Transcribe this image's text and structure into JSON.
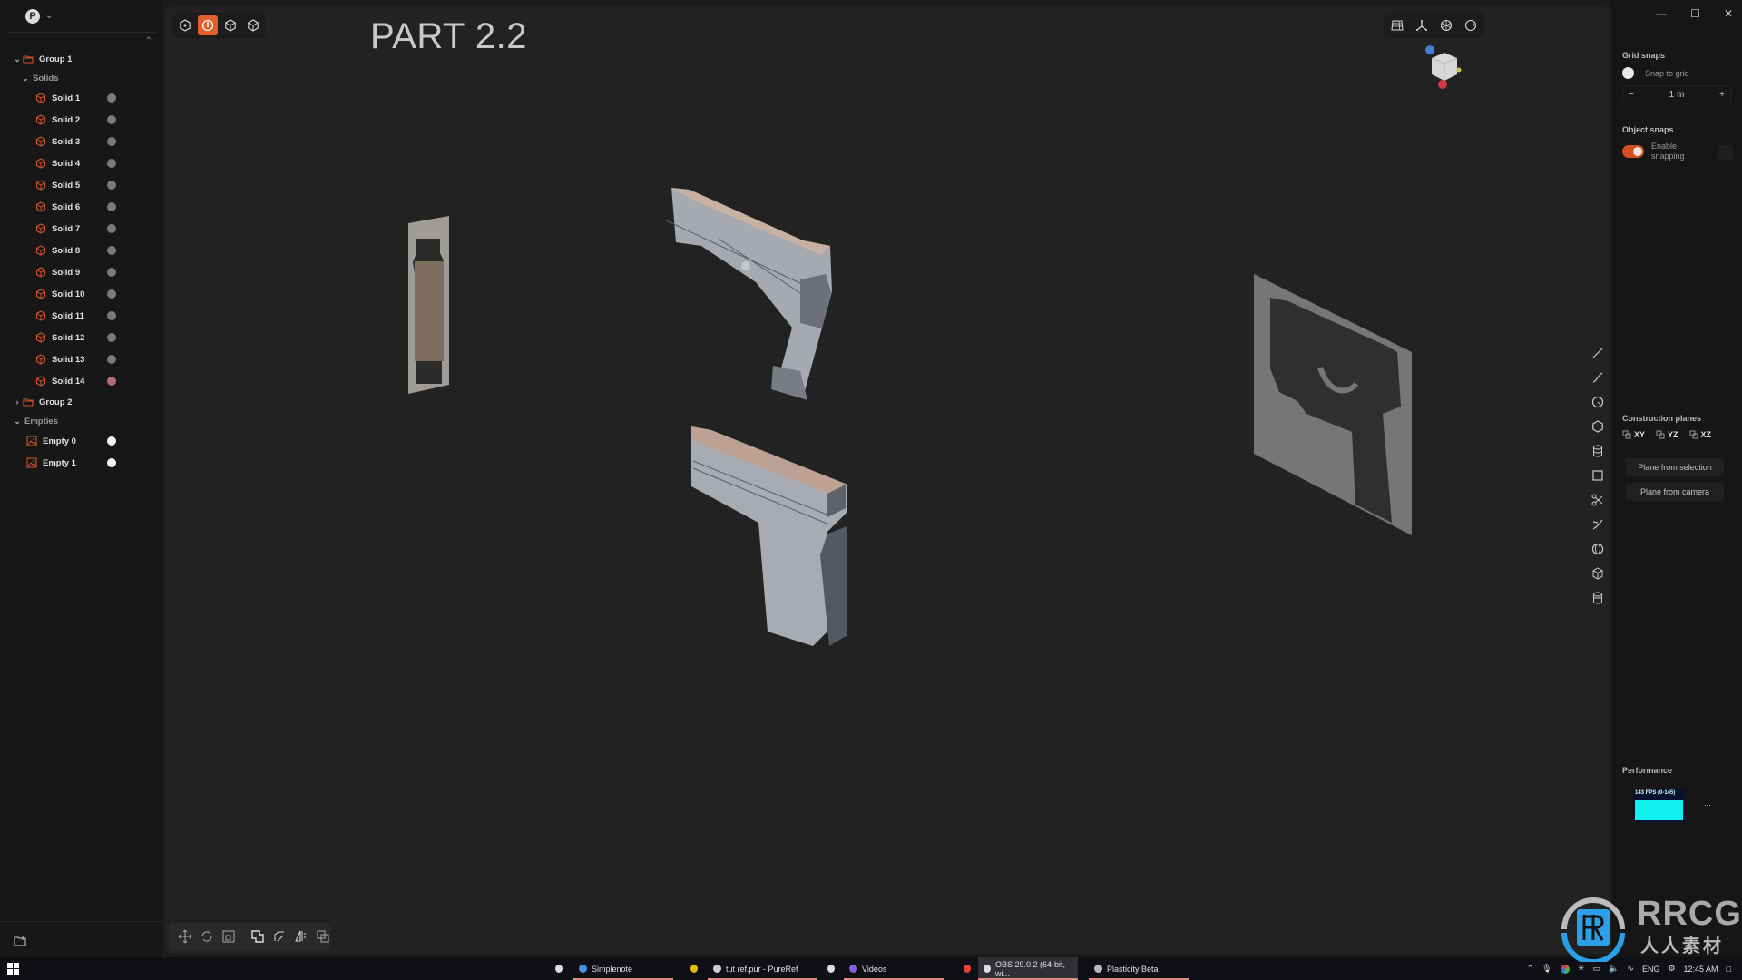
{
  "app": {
    "user_initial": "P",
    "title_overlay": "PART 2.2"
  },
  "outliner": {
    "groups": [
      {
        "label": "Group 1",
        "expanded": true,
        "sections": [
          {
            "label": "Solids",
            "items": [
              {
                "label": "Solid 1",
                "dot": "gray"
              },
              {
                "label": "Solid 2",
                "dot": "gray"
              },
              {
                "label": "Solid 3",
                "dot": "gray"
              },
              {
                "label": "Solid 4",
                "dot": "gray"
              },
              {
                "label": "Solid 5",
                "dot": "gray"
              },
              {
                "label": "Solid 6",
                "dot": "gray"
              },
              {
                "label": "Solid 7",
                "dot": "gray"
              },
              {
                "label": "Solid 8",
                "dot": "gray"
              },
              {
                "label": "Solid 9",
                "dot": "gray"
              },
              {
                "label": "Solid 10",
                "dot": "gray"
              },
              {
                "label": "Solid 11",
                "dot": "gray"
              },
              {
                "label": "Solid 12",
                "dot": "gray"
              },
              {
                "label": "Solid 13",
                "dot": "gray"
              },
              {
                "label": "Solid 14",
                "dot": "pink"
              }
            ]
          }
        ]
      },
      {
        "label": "Group 2",
        "expanded": false
      }
    ],
    "empties": {
      "label": "Empties",
      "items": [
        {
          "label": "Empty 0",
          "dot": "white"
        },
        {
          "label": "Empty 1",
          "dot": "white"
        }
      ]
    }
  },
  "viewport": {
    "top_tools": [
      "vertex-select-icon",
      "edge-select-icon",
      "face-select-icon",
      "solid-select-icon"
    ],
    "active_tool_index": 1,
    "right_tools": [
      "grid-icon",
      "axes-icon",
      "render-mode-icon",
      "xray-icon"
    ],
    "side_tools": [
      "line-icon",
      "curve-icon",
      "circle-icon",
      "polygon-icon",
      "cylinder-stack-icon",
      "rectangle-icon",
      "scissors-icon",
      "trim-icon",
      "sphere-icon",
      "box-icon",
      "cylinder-icon"
    ],
    "bottom_tools": [
      "move-icon",
      "rotate-icon",
      "scale-icon",
      "boolean-union-icon",
      "fillet-icon",
      "mirror-icon",
      "duplicate-icon"
    ],
    "accent": "#e0602a"
  },
  "right_panel": {
    "grid_snaps": {
      "heading": "Grid snaps",
      "snap_to_grid_label": "Snap to grid",
      "snap_to_grid": false,
      "size_value": "1 m",
      "minus": "−",
      "plus": "+"
    },
    "object_snaps": {
      "heading": "Object snaps",
      "enable_label_line1": "Enable",
      "enable_label_line2": "snapping",
      "enabled": true,
      "more": "..."
    },
    "construction_planes": {
      "heading": "Construction planes",
      "planes": [
        "XY",
        "YZ",
        "XZ"
      ],
      "from_selection": "Plane from selection",
      "from_camera": "Plane from camera"
    },
    "performance": {
      "heading": "Performance",
      "fps_label": "143 FPS (0-145)",
      "more": "..."
    }
  },
  "taskbar": {
    "items": [
      {
        "label": "",
        "icon": "app-icon"
      },
      {
        "label": "Simplenote",
        "icon": "simplenote-icon"
      },
      {
        "label": "",
        "icon": "app-yellow-icon"
      },
      {
        "label": "tut ref.pur - PureRef",
        "icon": "pureref-icon"
      },
      {
        "label": "",
        "icon": "app-icon"
      },
      {
        "label": "Videos",
        "icon": "videos-icon"
      },
      {
        "label": "",
        "icon": "chrome-icon"
      },
      {
        "label": "OBS 29.0.2 (64-bit, wi...",
        "icon": "obs-icon"
      },
      {
        "label": "Plasticity Beta",
        "icon": "plasticity-icon"
      }
    ],
    "tray": {
      "language": "ENG",
      "time": "12:45 AM"
    }
  },
  "watermark": {
    "line1": "RRCG",
    "line2": "人人素材"
  }
}
